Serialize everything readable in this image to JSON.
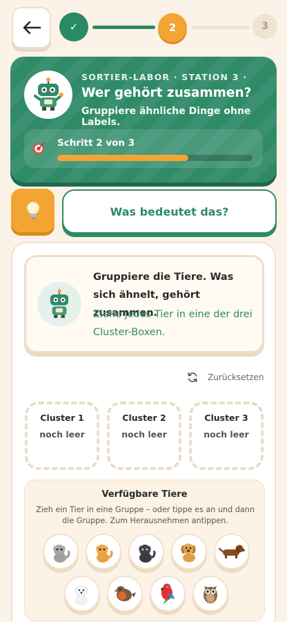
{
  "progress_steps": [
    {
      "label": "✓",
      "state": "done"
    },
    {
      "label": "2",
      "state": "current"
    },
    {
      "label": "3",
      "state": "upcoming"
    }
  ],
  "hero": {
    "eyebrow": "SORTIER-LABOR · STATION 3 ·",
    "title": "Wer gehört zusammen?",
    "subtitle": "Gruppiere ähnliche Dinge ohne Labels.",
    "progress_label": "Schritt 2 von 3",
    "progress_fraction": 0.67
  },
  "meaning_button_label": "Was bedeutet das?",
  "task": {
    "main": "Gruppiere die Tiere. Was sich ähnelt, gehört zusammen.",
    "sub": "Ziehe jedes Tier in eine der drei Cluster-Boxen."
  },
  "reset_label": "Zurücksetzen",
  "clusters": [
    {
      "title": "Cluster 1",
      "status": "noch leer"
    },
    {
      "title": "Cluster 2",
      "status": "noch leer"
    },
    {
      "title": "Cluster 3",
      "status": "noch leer"
    }
  ],
  "pool": {
    "title": "Verfügbare Tiere",
    "help": "Zieh ein Tier in eine Gruppe – oder tippe es an und dann die Gruppe. Zum Herausnehmen antippen.",
    "animals": [
      "gray-cat-icon",
      "orange-cat-icon",
      "black-cat-icon",
      "puppy-icon",
      "dachshund-icon",
      "white-dog-icon",
      "robin-icon",
      "parrot-icon",
      "owl-icon"
    ]
  },
  "colors": {
    "primary": "#2f8a68",
    "accent": "#f2a533",
    "background": "#fbf3e8"
  }
}
